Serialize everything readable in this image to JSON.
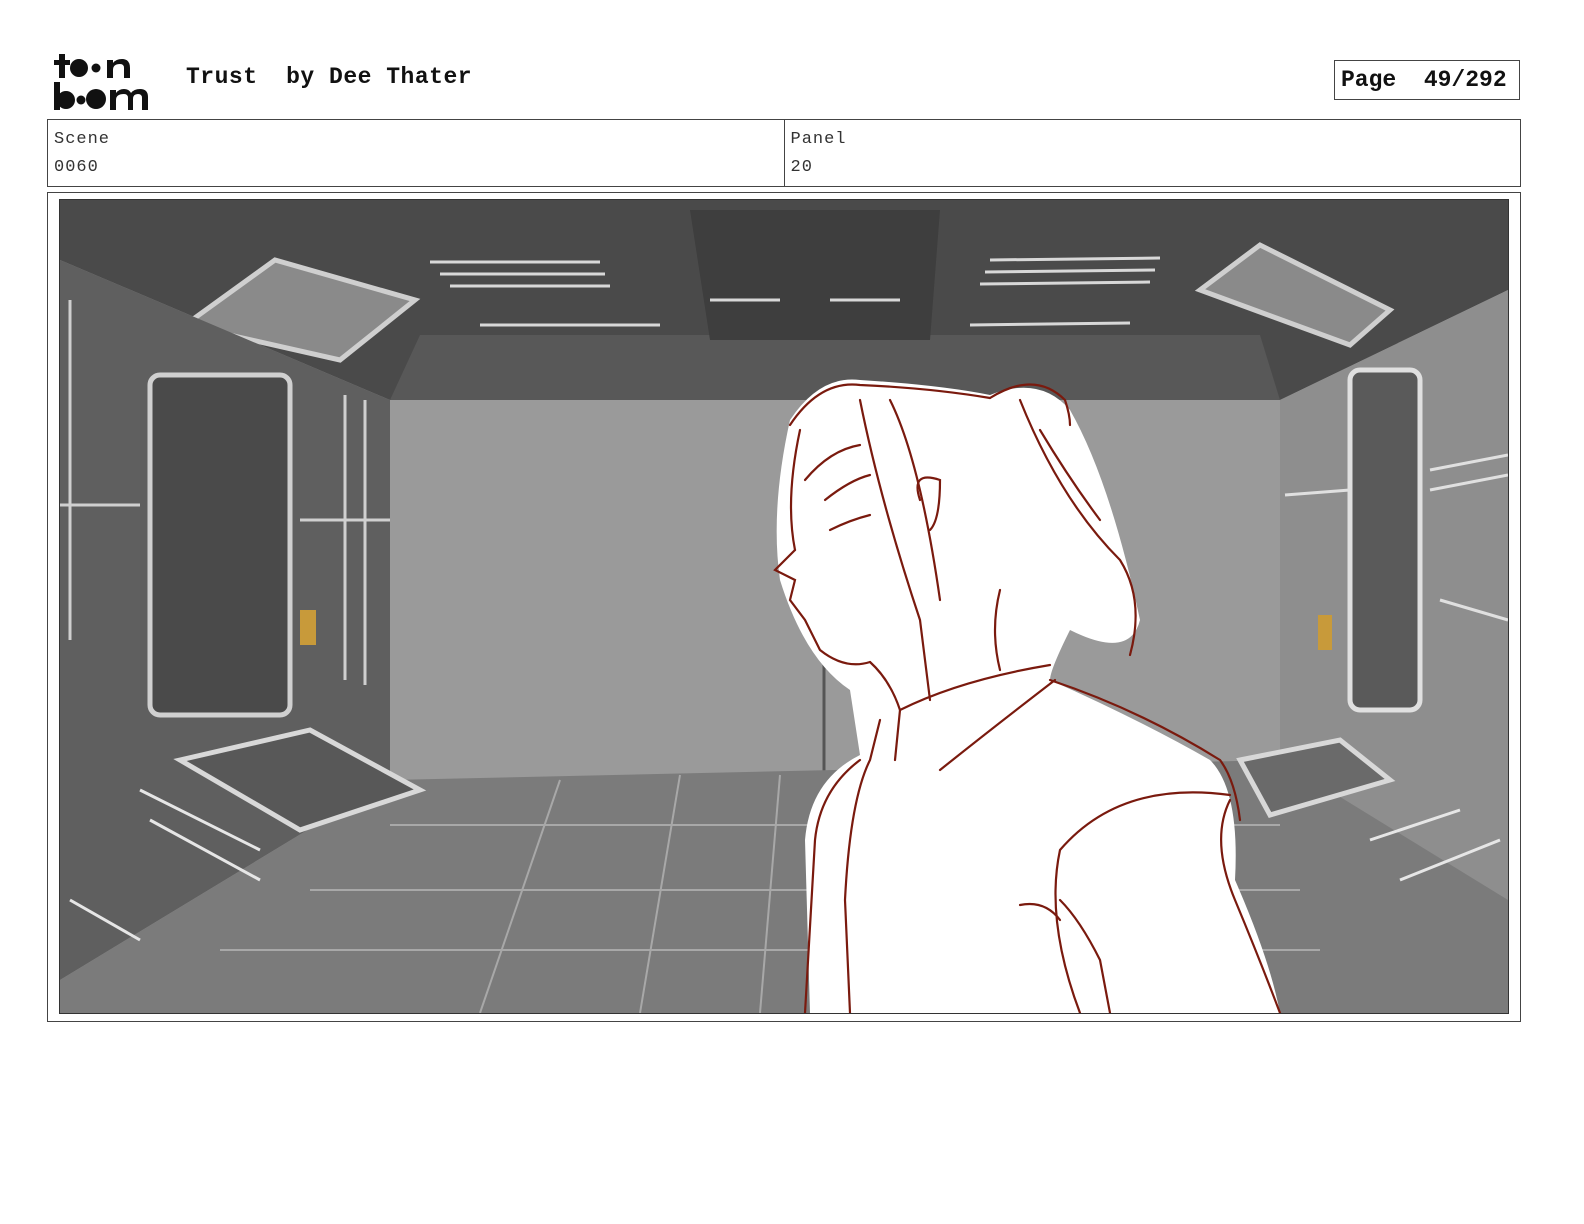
{
  "header": {
    "logo_text": "toon boom",
    "title": "Trust  by Dee Thater",
    "page": "Page  49/292"
  },
  "info": {
    "scene_label": "Scene",
    "scene_value": "0060",
    "panel_label": "Panel",
    "panel_value": "20"
  },
  "panel_image": {
    "description_icon": "storyboard-panel-image",
    "colors": {
      "sketch_line": "#7a1a0e",
      "back_wall": "#9a9a9a",
      "ceiling": "#4a4a4a",
      "floor": "#7d7d7d"
    }
  }
}
